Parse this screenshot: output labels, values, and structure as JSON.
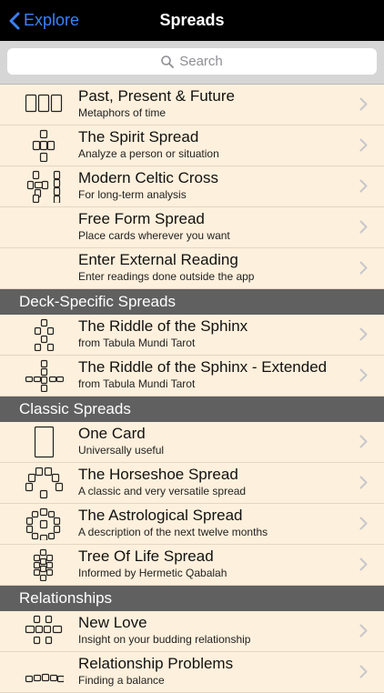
{
  "nav": {
    "back_label": "Explore",
    "title": "Spreads"
  },
  "search": {
    "placeholder": "Search"
  },
  "groups": [
    {
      "header": "",
      "items": [
        {
          "title": "Past, Present & Future",
          "subtitle": "Metaphors of time",
          "icon": "three-card-row-icon"
        },
        {
          "title": "The Spirit Spread",
          "subtitle": "Analyze a person or situation",
          "icon": "spirit-cross-icon"
        },
        {
          "title": "Modern Celtic Cross",
          "subtitle": "For long-term analysis",
          "icon": "celtic-cross-icon"
        },
        {
          "title": "Free Form Spread",
          "subtitle": "Place cards wherever you want",
          "icon": ""
        },
        {
          "title": "Enter External Reading",
          "subtitle": "Enter readings done outside the app",
          "icon": ""
        }
      ]
    },
    {
      "header": "Deck-Specific Spreads",
      "items": [
        {
          "title": "The Riddle of the Sphinx",
          "subtitle": "from Tabula Mundi Tarot",
          "icon": "sphinx-cross-icon"
        },
        {
          "title": "The Riddle of the Sphinx - Extended",
          "subtitle": "from Tabula Mundi Tarot",
          "icon": "sphinx-extended-icon"
        }
      ]
    },
    {
      "header": "Classic Spreads",
      "items": [
        {
          "title": "One Card",
          "subtitle": "Universally useful",
          "icon": "single-card-icon"
        },
        {
          "title": "The Horseshoe Spread",
          "subtitle": "A classic and very versatile spread",
          "icon": "horseshoe-icon"
        },
        {
          "title": "The Astrological Spread",
          "subtitle": "A description of the next twelve months",
          "icon": "astrological-circle-icon"
        },
        {
          "title": "Tree Of Life Spread",
          "subtitle": "Informed by Hermetic Qabalah",
          "icon": "tree-of-life-icon"
        }
      ]
    },
    {
      "header": "Relationships",
      "items": [
        {
          "title": "New Love",
          "subtitle": "Insight on your budding relationship",
          "icon": "new-love-icon"
        },
        {
          "title": "Relationship Problems",
          "subtitle": "Finding a balance",
          "icon": "relationship-problems-icon"
        }
      ]
    }
  ]
}
